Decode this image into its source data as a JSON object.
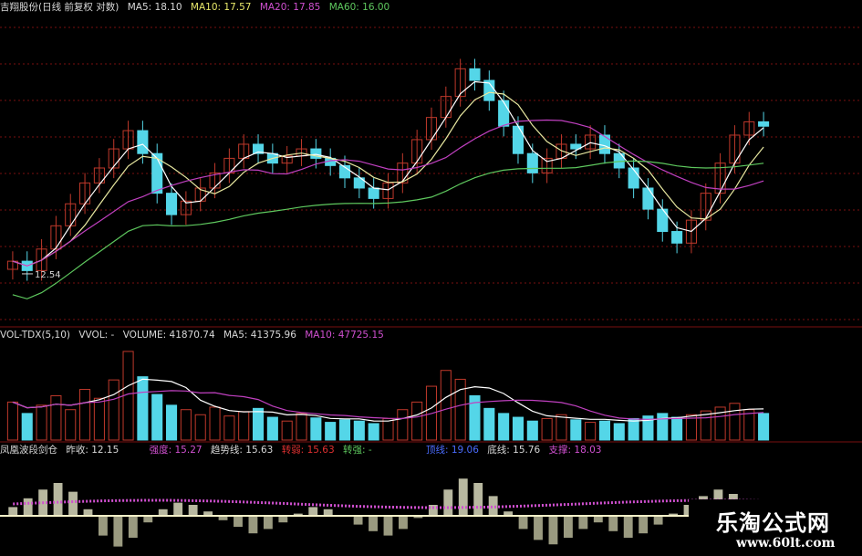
{
  "colors": {
    "up": "#c0392b",
    "down": "#54d6e8",
    "ma5": "#ffffff",
    "ma10": "#e8e8a0",
    "ma20": "#c040c0",
    "ma60": "#5ec85e",
    "grid": "#7a1010",
    "label_white": "#d8d8d8",
    "label_yellow": "#e8e86a",
    "label_magenta": "#d050d0",
    "label_green": "#5ec85e",
    "label_blue": "#4a6cff"
  },
  "price_panel": {
    "title": "吉翔股份(日线 前复权 对数)",
    "ma5_label": "MA5: 18.10",
    "ma10_label": "MA10: 17.57",
    "ma20_label": "MA20: 17.85",
    "ma60_label": "MA60: 16.00",
    "low_marker": "12.54"
  },
  "volume_panel": {
    "title": "VOL-TDX(5,10)",
    "vvol_label": "VVOL: -",
    "volume_label": "VOLUME: 41870.74",
    "ma5_label": "MA5: 41375.96",
    "ma10_label": "MA10: 47725.15"
  },
  "indicator_panel": {
    "title": "凤凰波段剑仓",
    "prev_close": "昨收: 12.15",
    "strength": "强度: 15.27",
    "trend": "趋势线: 15.63",
    "weak": "转弱: 15.63",
    "strong": "转强: -",
    "top": "顶线: 19.06",
    "bottom": "底线: 15.76",
    "support": "支撑: 18.03"
  },
  "watermark": {
    "title": "乐淘公式网",
    "url": "www.60lt.com"
  },
  "chart_data": [
    {
      "type": "candlestick",
      "title": "吉翔股份(日线 前复权 对数)",
      "series_names": [
        "MA5",
        "MA10",
        "MA20",
        "MA60"
      ],
      "latest_values": {
        "MA5": 18.1,
        "MA10": 17.57,
        "MA20": 17.85,
        "MA60": 16.0
      },
      "annotations": [
        "12.54"
      ],
      "close_estimate": [
        13.0,
        12.7,
        13.4,
        14.2,
        15.0,
        15.8,
        16.4,
        17.2,
        18.0,
        17.0,
        15.4,
        14.6,
        15.1,
        15.6,
        16.2,
        16.8,
        17.4,
        17.0,
        16.6,
        16.9,
        17.2,
        16.8,
        16.5,
        16.0,
        15.6,
        15.2,
        15.8,
        16.6,
        17.6,
        18.6,
        19.6,
        21.0,
        20.4,
        19.4,
        18.2,
        17.0,
        16.2,
        16.8,
        17.4,
        17.2,
        17.8,
        17.0,
        16.4,
        15.6,
        14.8,
        14.0,
        13.6,
        14.4,
        15.4,
        16.6,
        17.8,
        18.4,
        18.2
      ]
    },
    {
      "type": "bar",
      "title": "VOL-TDX(5,10)",
      "series_names": [
        "VOLUME",
        "MA5",
        "MA10"
      ],
      "latest_values": {
        "VOLUME": 41870.74,
        "MA5": 41375.96,
        "MA10": 47725.15
      },
      "volume_estimate": [
        60,
        42,
        55,
        70,
        48,
        80,
        66,
        95,
        140,
        100,
        72,
        55,
        48,
        40,
        52,
        38,
        45,
        50,
        36,
        30,
        42,
        35,
        28,
        32,
        30,
        26,
        34,
        48,
        60,
        85,
        110,
        96,
        70,
        50,
        42,
        36,
        30,
        34,
        40,
        32,
        28,
        30,
        26,
        34,
        38,
        42,
        36,
        40,
        46,
        52,
        58,
        48,
        42
      ]
    },
    {
      "type": "bar",
      "title": "凤凰波段剑仓",
      "labels": [
        "昨收: 12.15",
        "强度: 15.27",
        "趋势线: 15.63",
        "转弱: 15.63",
        "转强: -",
        "顶线: 19.06",
        "底线: 15.76",
        "支撑: 18.03"
      ],
      "oscillator_estimate": [
        0.8,
        1.6,
        2.4,
        3.0,
        2.2,
        0.6,
        -1.8,
        -2.8,
        -2.0,
        -0.6,
        0.6,
        1.2,
        1.0,
        0.4,
        -0.4,
        -1.0,
        -1.6,
        -1.2,
        -0.6,
        0.2,
        0.8,
        0.6,
        0.0,
        -0.8,
        -1.4,
        -1.8,
        -1.2,
        -0.2,
        1.0,
        2.4,
        3.4,
        3.0,
        1.8,
        0.4,
        -1.2,
        -2.2,
        -2.6,
        -2.0,
        -1.2,
        -0.6,
        -1.4,
        -2.0,
        -1.6,
        -0.8,
        0.2,
        1.0,
        1.8,
        2.4,
        2.0,
        1.4,
        0.6
      ]
    }
  ]
}
